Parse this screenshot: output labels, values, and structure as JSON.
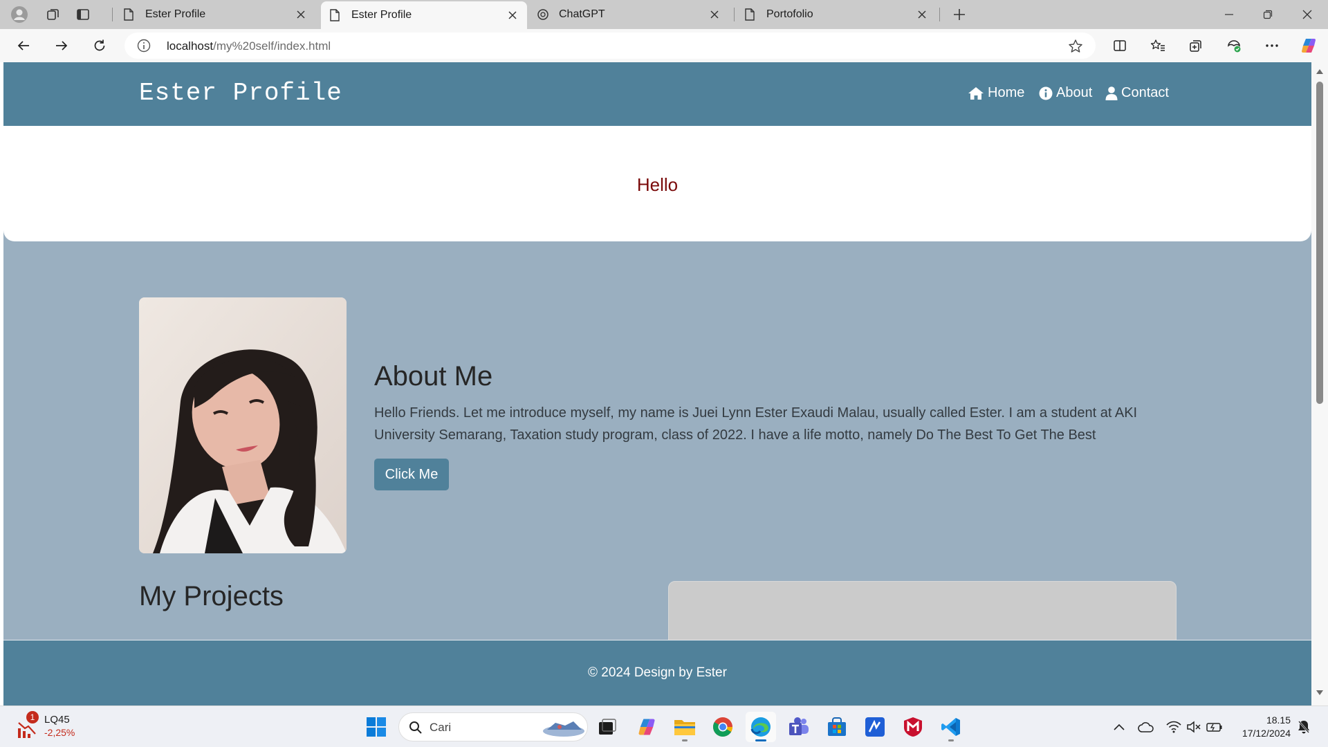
{
  "browser": {
    "tabs": [
      {
        "title": "Ester Profile",
        "active": false
      },
      {
        "title": "Ester Profile",
        "active": true
      },
      {
        "title": "ChatGPT",
        "active": false
      },
      {
        "title": "Portofolio",
        "active": false
      }
    ],
    "url_host": "localhost",
    "url_path": "/my%20self/index.html",
    "icons": [
      "profile-icon",
      "workspaces-icon",
      "tab-actions-icon",
      "new-tab-icon",
      "minimize-icon",
      "restore-icon",
      "close-window-icon",
      "back-icon",
      "forward-icon",
      "refresh-icon",
      "site-info-icon",
      "favorite-star-icon",
      "split-screen-icon",
      "favorites-icon",
      "collections-icon",
      "browser-essentials-icon",
      "more-icon",
      "copilot-icon"
    ]
  },
  "page": {
    "brand": "Ester Profile",
    "nav": [
      {
        "label": "Home",
        "icon": "home-icon"
      },
      {
        "label": "About",
        "icon": "info-icon"
      },
      {
        "label": "Contact",
        "icon": "user-icon"
      }
    ],
    "hero_text": "Hello",
    "about": {
      "title": "About Me",
      "text": "Hello Friends. Let me introduce myself, my name is Juei Lynn Ester Exaudi Malau, usually called Ester. I am a student at AKI University Semarang, Taxation study program, class of 2022. I have a life motto, namely Do The Best To Get The Best",
      "button": "Click Me"
    },
    "projects_title": "My Projects",
    "footer": "© 2024 Design by Ester",
    "colors": {
      "primary": "#50819a",
      "background": "#9aafc0",
      "hero_text": "#7a0a0a"
    }
  },
  "taskbar": {
    "widget": {
      "name": "LQ45",
      "value": "-2,25%",
      "badge": "1"
    },
    "search_placeholder": "Cari",
    "time": "18.15",
    "date": "17/12/2024"
  }
}
